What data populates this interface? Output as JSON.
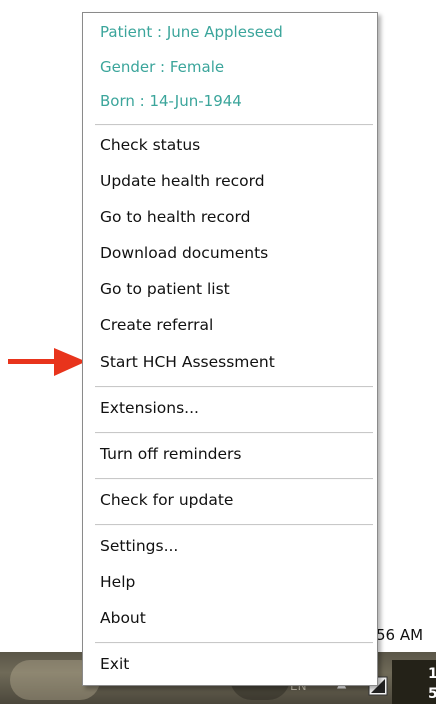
{
  "patient_info": {
    "patient": "Patient : June Appleseed",
    "gender": "Gender : Female",
    "born": "Born : 14-Jun-1944"
  },
  "menu_items": {
    "check_status": "Check status",
    "update_health_record": "Update health record",
    "go_to_health_record": "Go to health record",
    "download_documents": "Download documents",
    "go_to_patient_list": "Go to patient list",
    "create_referral": "Create referral",
    "start_hch_assessment": "Start HCH Assessment",
    "extensions": "Extensions...",
    "turn_off_reminders": "Turn off reminders",
    "check_for_update": "Check for update",
    "settings": "Settings...",
    "help": "Help",
    "about": "About",
    "exit": "Exit"
  },
  "taskbar": {
    "clock_fragment": "56 AM",
    "language": "EN",
    "tray_digit_top": "1",
    "tray_digit_bottom": "5"
  },
  "colors": {
    "info_text": "#3ba59b",
    "arrow": "#e8341c"
  },
  "icons": {
    "annotation_arrow": "arrow-right-icon",
    "tray_up": "chevron-up-icon",
    "tray_network": "network-icon"
  }
}
